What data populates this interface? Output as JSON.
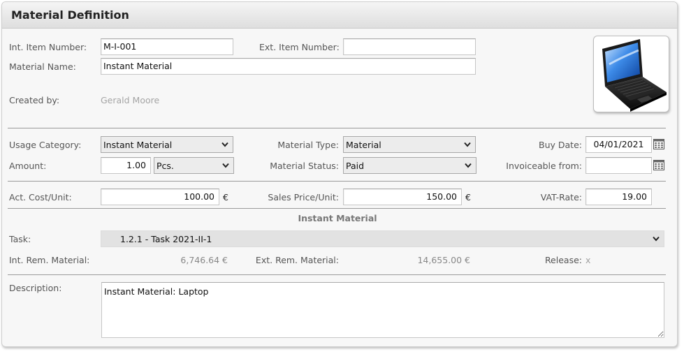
{
  "header": {
    "title": "Material Definition"
  },
  "general": {
    "int_item_number_label": "Int. Item Number:",
    "int_item_number_value": "M-I-001",
    "ext_item_number_label": "Ext. Item Number:",
    "ext_item_number_value": "",
    "material_name_label": "Material Name:",
    "material_name_value": "Instant Material",
    "created_by_label": "Created by:",
    "created_by_value": "Gerald Moore",
    "image_icon": "laptop-image"
  },
  "usage": {
    "usage_category_label": "Usage Category:",
    "usage_category_value": "Instant Material",
    "material_type_label": "Material Type:",
    "material_type_value": "Material",
    "buy_date_label": "Buy Date:",
    "buy_date_value": "04/01/2021",
    "amount_label": "Amount:",
    "amount_value": "1.00",
    "unit_value": "Pcs.",
    "material_status_label": "Material Status:",
    "material_status_value": "Paid",
    "invoiceable_from_label": "Invoiceable from:",
    "invoiceable_from_value": ""
  },
  "pricing": {
    "act_cost_label": "Act. Cost/Unit:",
    "act_cost_value": "100.00",
    "sales_price_label": "Sales Price/Unit:",
    "sales_price_value": "150.00",
    "currency": "€",
    "vat_rate_label": "VAT-Rate:",
    "vat_rate_value": "19.00"
  },
  "section": {
    "title": "Instant Material"
  },
  "task": {
    "task_label": "Task:",
    "task_value": "1.2.1 - Task 2021-II-1",
    "int_rem_label": "Int. Rem. Material:",
    "int_rem_value": "6,746.64 €",
    "ext_rem_label": "Ext. Rem. Material:",
    "ext_rem_value": "14,655.00 €",
    "release_label": "Release:",
    "release_value": "x"
  },
  "description": {
    "label": "Description:",
    "value": "Instant Material: Laptop"
  },
  "colors": {
    "panel_bg": "#f7f7f7",
    "header_gradient_top": "#f5f5f5",
    "header_gradient_bottom": "#dedede",
    "readonly_text": "#888888"
  }
}
